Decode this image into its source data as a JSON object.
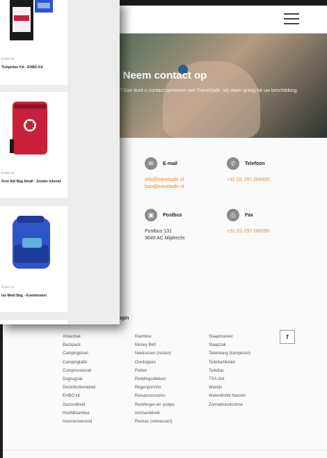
{
  "contact_page": {
    "hero": {
      "title": "Neem contact op",
      "subtitle": "Vragen? Dan kunt u contact opnemen met TravelSafe, wij staan graag tot uw beschikking."
    },
    "contacts": [
      {
        "icon": "mail-icon",
        "label": "E-mail",
        "lines": [
          "info@travelsafe.nl",
          "bao@travelsafe.nl"
        ],
        "color": "#e98a2a"
      },
      {
        "icon": "phone-icon",
        "label": "Telefoon",
        "lines": [
          "+31 (0) 297 264400"
        ],
        "color": "#e98a2a"
      },
      {
        "icon": "mailbox-icon",
        "label": "Postbus",
        "lines": [
          "Postbus 131",
          "3640 AC Mijdrecht"
        ],
        "color": "#333333"
      },
      {
        "icon": "fax-icon",
        "label": "Fax",
        "lines": [
          "+31 (0) 297 288298"
        ],
        "color": "#e98a2a"
      }
    ],
    "footer": {
      "heading": "r login",
      "columns": [
        [
          "Afwasbak",
          "Backpack",
          "Campingstoel",
          "Campingtafel",
          "Compressiezak",
          "Dagrugzak",
          "Desinfectiemiddel",
          "EHBO kit",
          "Gezondheid",
          "Hoofdklamboe",
          "Insectenwerend"
        ],
        [
          "Klamboe",
          "Money Belt",
          "Nekkussen (reizen)",
          "Oordoppen",
          "Petten",
          "Reddingsdekken",
          "Regenponcho",
          "Reisaccessoires",
          "Reisflesjes en -potjes",
          "reishanddoek",
          "Reistas (volwassen)"
        ],
        [
          "Slaapmasker",
          "Slaapzak",
          "Tekentang (kamperen)",
          "Toilettartikelen",
          "Toilettas",
          "TSA slot",
          "Waslijn",
          "Waterdichte hoezen",
          "Zonnebrandcrème"
        ]
      ],
      "social": "f"
    }
  },
  "product_list": {
    "products": [
      {
        "category": "EHBO kit",
        "name": "Tickpicker Kit - EHBO Kit"
      },
      {
        "category": "EHBO kit",
        "name": "First Aid Bag Small - Zonder inhoud"
      },
      {
        "category": "EHBO kit",
        "name": "Iso Medi Bag - Koelelement"
      }
    ]
  },
  "colors": {
    "accent": "#e98a2a",
    "bag_red": "#c8203a",
    "bag_blue": "#2f54c8"
  }
}
